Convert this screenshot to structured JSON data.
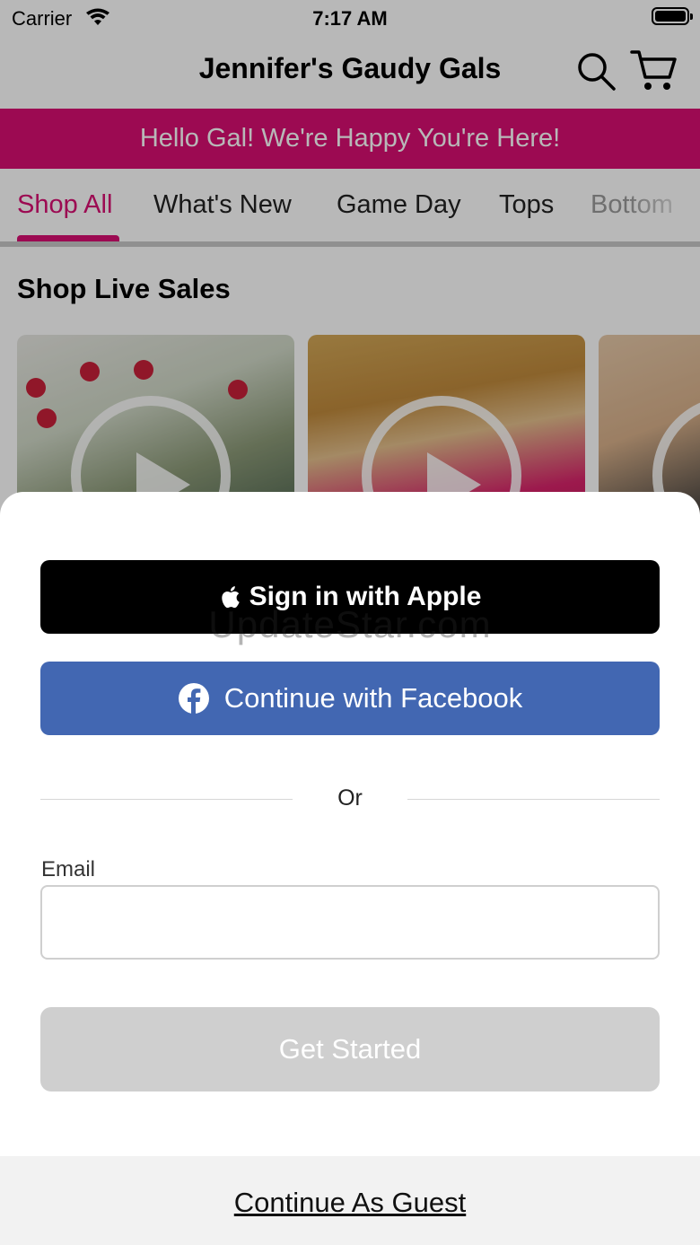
{
  "status_bar": {
    "carrier": "Carrier",
    "time": "7:17 AM"
  },
  "header": {
    "title": "Jennifer's Gaudy Gals",
    "icons": [
      "search-icon",
      "cart-icon"
    ]
  },
  "banner": {
    "text": "Hello Gal! We're Happy You're Here!",
    "color": "#d90f72"
  },
  "tabs": [
    {
      "label": "Shop All",
      "active": true
    },
    {
      "label": "What's New",
      "active": false
    },
    {
      "label": "Game Day",
      "active": false
    },
    {
      "label": "Tops",
      "active": false
    },
    {
      "label": "Bottom",
      "active": false
    }
  ],
  "live_sales": {
    "title": "Shop Live Sales"
  },
  "auth_sheet": {
    "apple_label": "Sign in with Apple",
    "facebook_label": "Continue with Facebook",
    "facebook_color": "#4267b2",
    "or_text": "Or",
    "email_label": "Email",
    "email_value": "",
    "get_started_label": "Get Started",
    "guest_label": "Continue As Guest"
  },
  "watermark": "UpdateStar.com"
}
